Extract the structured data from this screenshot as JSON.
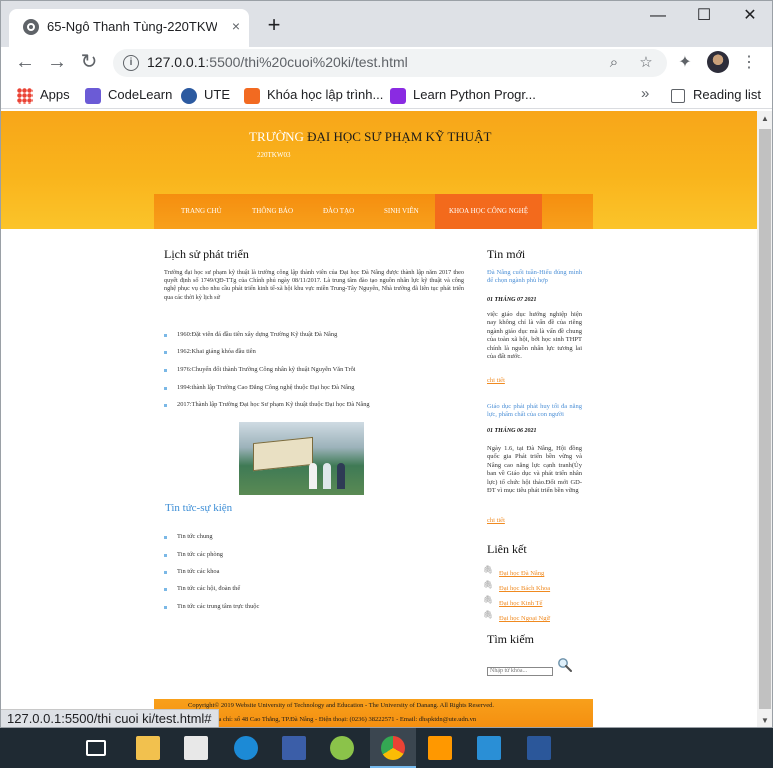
{
  "browser": {
    "tab_title": "65-Ngô Thanh Tùng-220TKW03",
    "tab_close": "×",
    "new_tab": "+",
    "url_main": "127.0.0.1",
    "url_rest": ":5500/thi%20cuoi%20ki/test.html",
    "minimize": "—",
    "maximize": "☐",
    "close": "✕",
    "status_url": "127.0.0.1:5500/thi cuoi ki/test.html#"
  },
  "bookmarks": [
    {
      "label": "Apps",
      "color": "#4285f4"
    },
    {
      "label": "CodeLearn",
      "color": "#6b5bd6"
    },
    {
      "label": "UTE",
      "color": "#2c5aa0"
    },
    {
      "label": "Khóa học lập trình...",
      "color": "#f26a21"
    },
    {
      "label": "Learn Python Progr...",
      "color": "#8a2be2"
    }
  ],
  "bookmarks_more": "»",
  "reading_list": "Reading list",
  "site": {
    "title_white": "TRƯỜNG",
    "title_dark": " ĐẠI HỌC SƯ PHẠM KỸ THUẬT",
    "subtitle": "220TKW03",
    "accent_orange": "#f8a619",
    "menu": [
      "TRANG CHỦ",
      "THÔNG BÁO",
      "ĐÀO TẠO",
      "SINH VIÊN",
      "KHOA HỌC CÔNG NGHỆ"
    ]
  },
  "main": {
    "history_heading": "Lịch sử phát triển",
    "history_paragraph": "Trường đại học sư phạm kỹ thuật là trường công lập thành viên của Đại học Đà Nẵng được thành lập năm 2017 theo quyết định số 1749/QĐ-TTg của Chính phủ ngày 08/11/2017. Là trung tâm đào tạo nguồn nhân lực kỹ thuật và công nghệ phục vụ cho nhu cầu phát triển kinh tế-xã hội khu vực miền Trung-Tây Nguyên, Nhà trường đã liên tục phát triển qua các thời kỳ lịch sử",
    "milestones": [
      "1960:Đặt viên đá đầu tiên xây dựng Trường Kỹ thuật Đà Nẵng",
      "1962:Khai giảng khóa đầu tiên",
      "1976:Chuyển đổi thành Trường Công nhân kỹ thuật Nguyễn Văn Trỗi",
      "1994:thành lập Trường Cao Đẳng Công nghệ thuộc Đại học Đà Nẵng",
      "2017:Thành lập Trường Đại học Sư phạm Kỹ thuật thuộc Đại học Đà Nẵng"
    ],
    "events_heading": "Tin tức-sự kiện",
    "events": [
      "Tin tức chung",
      "Tin tức các phòng",
      "Tin tức các khoa",
      "Tin tức các hội, đoàn thể",
      "Tin tức các trung tâm trực thuộc"
    ]
  },
  "sidebar": {
    "news_heading": "Tin mới",
    "news": [
      {
        "title": "Đà Nẵng cuối tuần-Hiểu đúng mình để chọn ngành phù hợp",
        "date": "01 THÁNG 07 2021",
        "text": "việc giáo dục hướng nghiệp hiện nay không chỉ là vấn đề của riêng ngành giáo dục mà là vấn đề chung của toàn xã hội, bởi học sinh THPT chính là nguồn nhân lực tương lai của đất nước.",
        "more": "chi tiết"
      },
      {
        "title": "Giáo dục phải phát huy tối đa năng lực, phẩm chất của con người",
        "date": "01 THÁNG 06 2021",
        "text": "Ngày 1.6, tại Đà Nẵng, Hội đồng quốc gia Phát triển bền vững và Nâng cao năng lực cạnh tranh(Ủy ban về Giáo dục và phát triển nhân lực) tổ chức hội thảo.Đối mới GD-ĐT vì mục tiêu phát triển bền vững",
        "more": "chi tiết"
      }
    ],
    "links_heading": "Liên kết",
    "links": [
      "Đại học Đà Nẵng",
      "Đại học Bách Khoa",
      "Đại học Kinh Tế",
      "Đại học Ngoại Ngữ"
    ],
    "search_heading": "Tìm kiếm",
    "search_placeholder": "Nhập từ khóa..."
  },
  "footer": {
    "line1": "Copyright© 2019 Website University of Technology and Education - The University of Danang. All Rights Reserved.",
    "line2": "Địa chỉ: số 48 Cao Thắng, TP.Đà Nẵng - Điện thoại: (0236) 38222571 - Email: dhspktdn@ute.udn.vn"
  },
  "taskbar": {
    "icons": [
      "task-view-icon",
      "file-explorer-icon",
      "microsoft-store-icon",
      "edge-icon",
      "dev-c-icon",
      "app-green-icon",
      "chrome-icon",
      "sublime-text-icon",
      "vscode-icon",
      "word-icon"
    ]
  }
}
